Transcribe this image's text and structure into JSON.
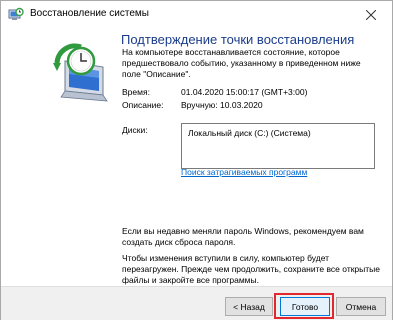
{
  "window": {
    "title": "Восстановление системы"
  },
  "icons": {
    "app": "system-restore-icon",
    "close": "close-icon",
    "art": "system-restore-illustration"
  },
  "main": {
    "heading": "Подтверждение точки восстановления",
    "description": "На компьютере восстанавливается состояние, которое предшествовало событию, указанному в приведенном ниже поле \"Описание\".",
    "time_label": "Время:",
    "time_value": "01.04.2020 15:00:17 (GMT+3:00)",
    "description_label": "Описание:",
    "description_value": "Вручную: 10.03.2020",
    "disks_label": "Диски:",
    "disks": [
      "Локальный диск (C:) (Система)"
    ],
    "affected_link": "Поиск затрагиваемых программ",
    "note_password": "Если вы недавно меняли пароль Windows, рекомендуем вам создать диск сброса пароля.",
    "note_restart": "Чтобы изменения вступили в силу, компьютер будет перезагружен. Прежде чем продолжить, сохраните все открытые файлы и закройте все программы."
  },
  "buttons": {
    "back": "< Назад",
    "finish": "Готово",
    "cancel": "Отмена"
  },
  "colors": {
    "heading": "#1a3c8a",
    "link": "#0066cc",
    "highlight": "#e0282e"
  }
}
